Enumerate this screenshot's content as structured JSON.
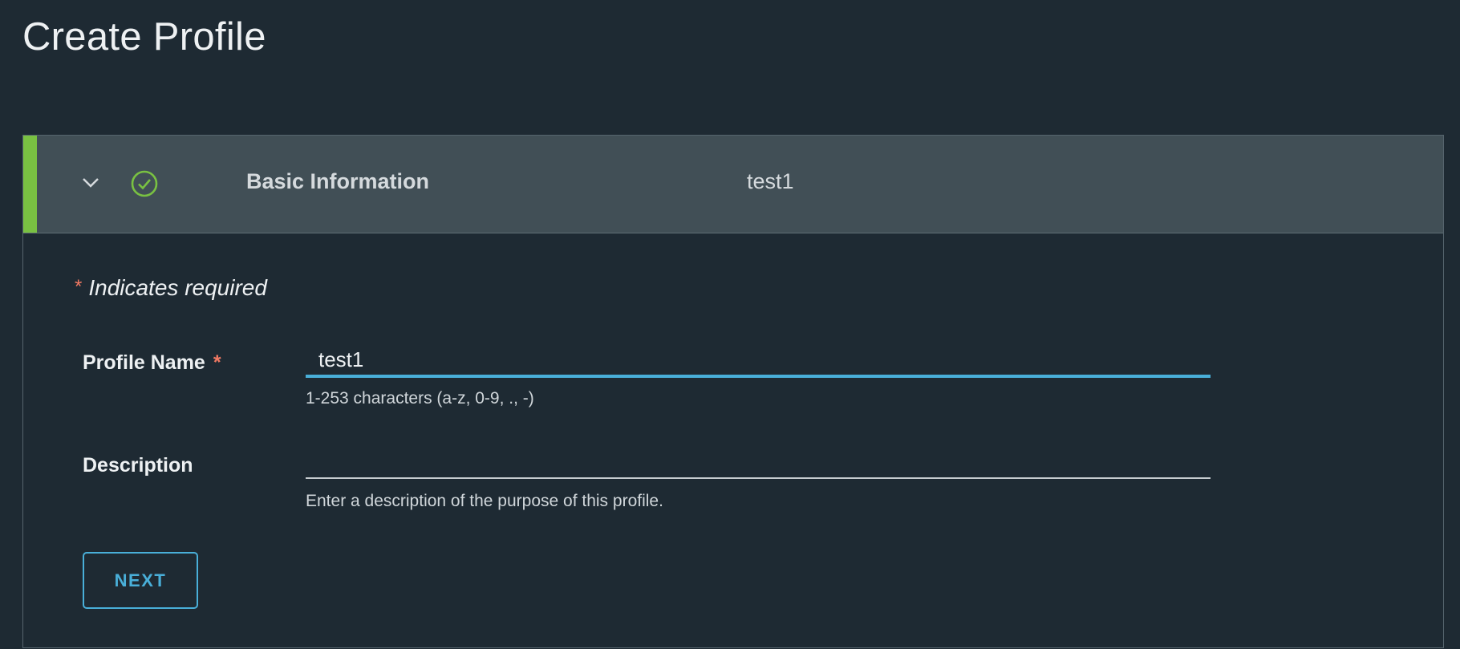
{
  "page": {
    "title": "Create Profile"
  },
  "step": {
    "title": "Basic Information",
    "summary": "test1",
    "status": "complete",
    "status_color": "#79c142",
    "expand_icon": "chevron-down-icon",
    "status_icon": "check-circle-icon"
  },
  "form": {
    "required_star": "*",
    "required_note": "Indicates required",
    "profile_name": {
      "label": "Profile Name",
      "required_star": "*",
      "value": "test1",
      "helper": "1-253 characters (a-z, 0-9, ., -)"
    },
    "description": {
      "label": "Description",
      "value": "",
      "helper": "Enter a description of the purpose of this profile."
    },
    "next_label": "NEXT"
  },
  "colors": {
    "background": "#1e2a33",
    "header_background": "#414f56",
    "accent": "#49afd9",
    "required": "#f27963",
    "success": "#79c142"
  }
}
